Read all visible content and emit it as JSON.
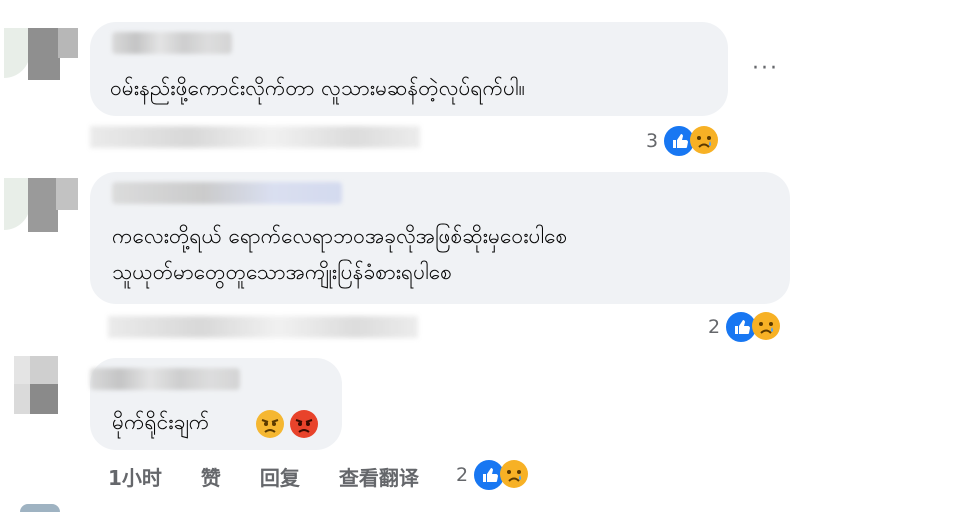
{
  "comments": [
    {
      "text_lines": [
        "ဝမ်းနည်းဖို့ကောင်းလိုက်တာ လူသားမဆန်တဲ့လုပ်ရက်ပါ။"
      ],
      "reaction_count": "3",
      "reactions": [
        "like-icon",
        "sad-icon"
      ]
    },
    {
      "text_lines": [
        "ကလေးတို့ရယ် ရောက်လေရာဘဝအခုလိုအဖြစ်ဆိုးမှဝေးပါစေ",
        "သူယုတ်မာတွေတူသောအကျိုးပြန်ခံစားရပါစေ"
      ],
      "reaction_count": "2",
      "reactions": [
        "like-icon",
        "sad-icon"
      ]
    },
    {
      "text_lines": [
        "မိုက်ရိုင်းချက်"
      ],
      "reaction_count": "2",
      "reactions": [
        "like-icon",
        "sad-icon"
      ],
      "inline_emojis": [
        "angry-face-icon",
        "pouting-face-icon"
      ],
      "time": "1小时",
      "like_label": "赞",
      "reply_label": "回复",
      "translate_label": "查看翻译"
    }
  ],
  "more_options": "···",
  "colors": {
    "bubble": "#f0f2f5",
    "meta_text": "#65676b",
    "like_blue": "#1877f2",
    "emoji_yellow": "#f7b125"
  }
}
